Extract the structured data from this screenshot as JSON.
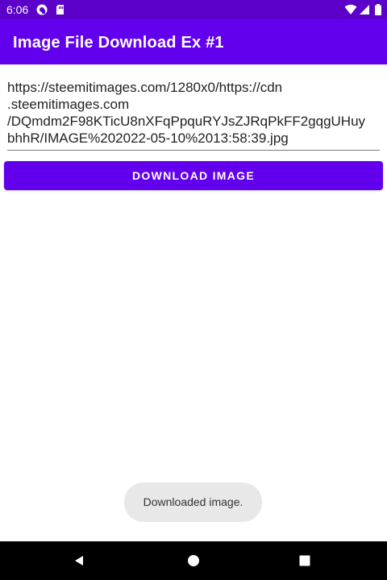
{
  "status_bar": {
    "time": "6:06",
    "background": "#5a00c8",
    "icons": [
      "app-notification-icon",
      "sim-card-icon",
      "wifi-icon",
      "signal-icon",
      "battery-icon"
    ]
  },
  "app_bar": {
    "title": "Image File Download Ex #1",
    "background": "#6200ee"
  },
  "url_input": {
    "value": "https://steemitimages.com/1280x0/https://cdn\n.steemitimages.com\n/DQmdm2F98KTicU8nXFqPpquRYJsZJRqPkFF2gqgUHuy\nbhhR/IMAGE%202022-05-10%2013:58:39.jpg"
  },
  "download_button": {
    "label": "DOWNLOAD IMAGE",
    "color": "#6200ee"
  },
  "toast": {
    "message": "Downloaded image."
  },
  "navigation_bar": {
    "buttons": [
      "back-icon",
      "home-icon",
      "recents-icon"
    ]
  }
}
